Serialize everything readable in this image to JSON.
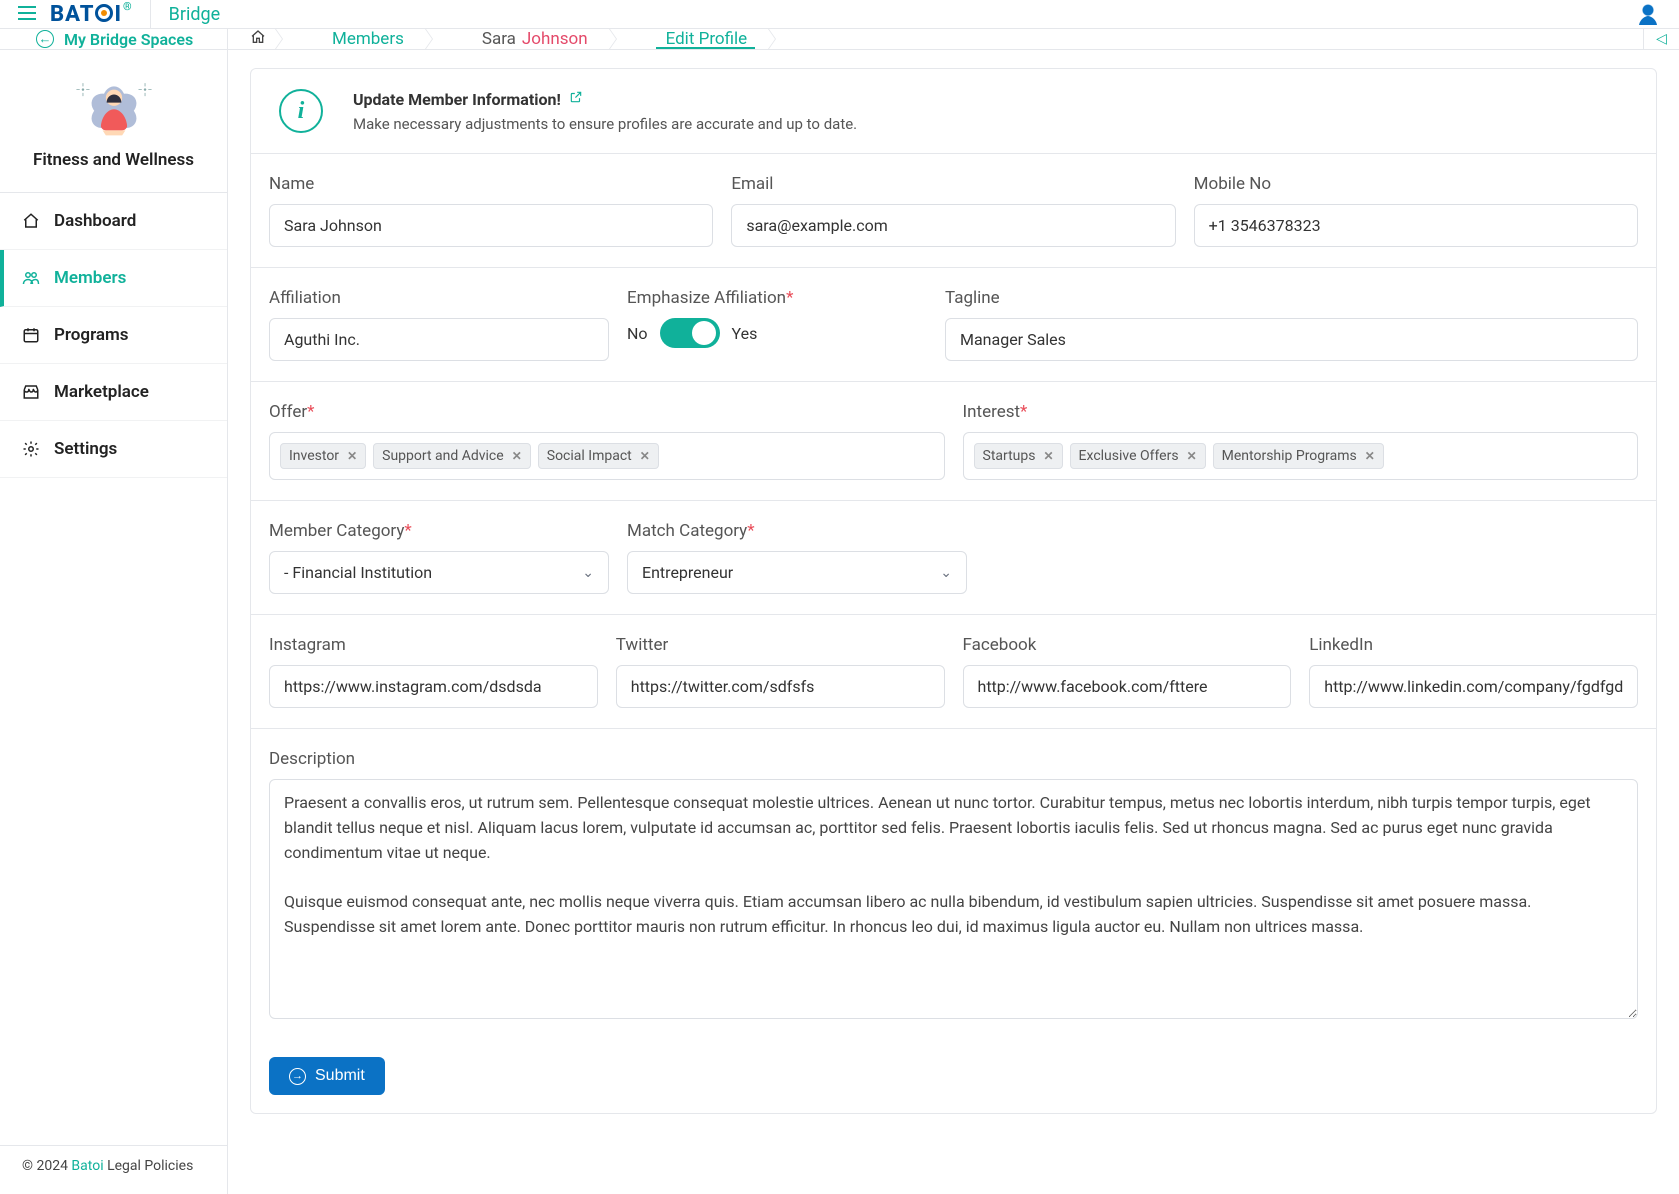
{
  "header": {
    "brand_sub": "Bridge"
  },
  "subheader": {
    "my_spaces_label": "My Bridge Spaces",
    "crumbs": {
      "members": "Members",
      "member_first": "Sara",
      "member_last": "Johnson",
      "current": "Edit Profile"
    }
  },
  "space": {
    "name": "Fitness and Wellness"
  },
  "sidebar": {
    "items": [
      {
        "label": "Dashboard",
        "icon": "home-icon",
        "active": false
      },
      {
        "label": "Members",
        "icon": "users-icon",
        "active": true
      },
      {
        "label": "Programs",
        "icon": "calendar-icon",
        "active": false
      },
      {
        "label": "Marketplace",
        "icon": "store-icon",
        "active": false
      },
      {
        "label": "Settings",
        "icon": "gear-icon",
        "active": false
      }
    ],
    "footer": {
      "copyright": "© 2024 ",
      "brand": "Batoi",
      "tail": " Legal Policies"
    }
  },
  "info": {
    "title": "Update Member Information!",
    "desc": "Make necessary adjustments to ensure profiles are accurate and up to date."
  },
  "form": {
    "labels": {
      "name": "Name",
      "email": "Email",
      "mobile": "Mobile No",
      "affiliation": "Affiliation",
      "emph_aff": "Emphasize Affiliation",
      "tagline": "Tagline",
      "offer": "Offer",
      "interest": "Interest",
      "member_cat": "Member Category",
      "match_cat": "Match Category",
      "instagram": "Instagram",
      "twitter": "Twitter",
      "facebook": "Facebook",
      "linkedin": "LinkedIn",
      "description": "Description",
      "no": "No",
      "yes": "Yes",
      "submit": "Submit"
    },
    "values": {
      "name": "Sara Johnson",
      "email": "sara@example.com",
      "mobile": "+1 3546378323",
      "affiliation": "Aguthi Inc.",
      "emphasize_affiliation": true,
      "tagline": "Manager Sales",
      "offer": [
        "Investor",
        "Support and Advice",
        "Social Impact"
      ],
      "interest": [
        "Startups",
        "Exclusive Offers",
        "Mentorship Programs"
      ],
      "member_category": "- Financial Institution",
      "match_category": "Entrepreneur",
      "instagram": "https://www.instagram.com/dsdsda",
      "twitter": "https://twitter.com/sdfsfs",
      "facebook": "http://www.facebook.com/fttere",
      "linkedin": "http://www.linkedin.com/company/fgdfgd",
      "description": "Praesent a convallis eros, ut rutrum sem. Pellentesque consequat molestie ultrices. Aenean ut nunc tortor. Curabitur tempus, metus nec lobortis interdum, nibh turpis tempor turpis, eget blandit tellus neque et nisl. Aliquam lacus lorem, vulputate id accumsan ac, porttitor sed felis. Praesent lobortis iaculis felis. Sed ut rhoncus magna. Sed ac purus eget nunc gravida condimentum vitae ut neque.\n\nQuisque euismod consequat ante, nec mollis neque viverra quis. Etiam accumsan libero ac nulla bibendum, id vestibulum sapien ultricies. Suspendisse sit amet posuere massa. Suspendisse sit amet lorem ante. Donec porttitor mauris non rutrum efficitur. In rhoncus leo dui, id maximus ligula auctor eu. Nullam non ultrices massa."
    }
  }
}
